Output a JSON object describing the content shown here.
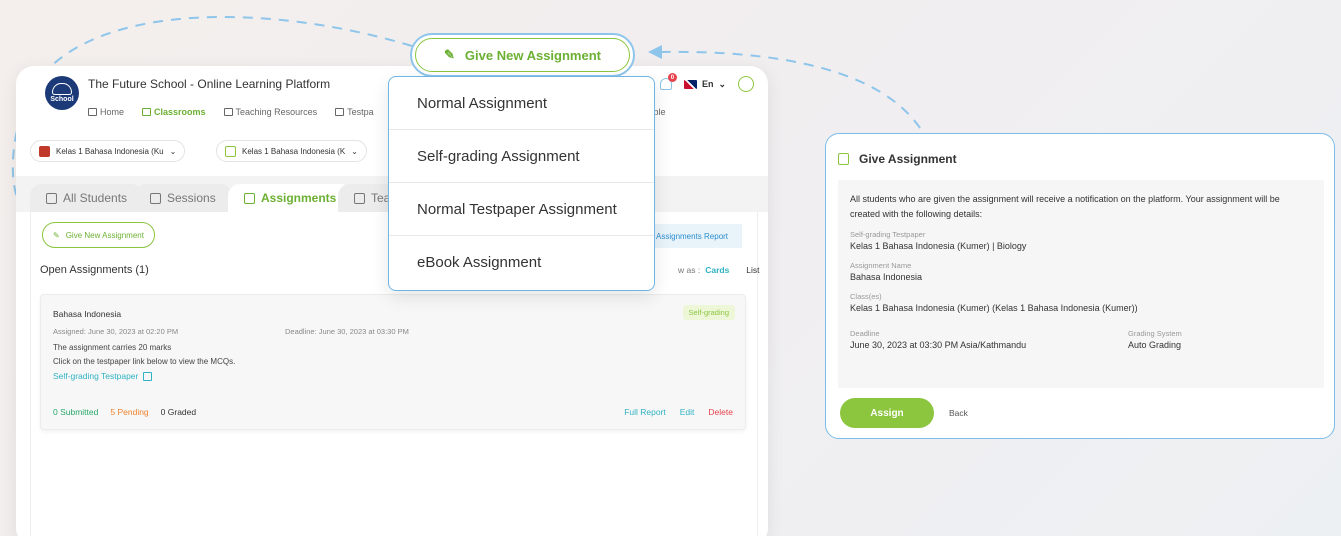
{
  "callout": {
    "label": "Give New Assignment"
  },
  "app": {
    "title": "The Future School - Online Learning Platform",
    "logo_text": "School",
    "nav": [
      "Home",
      "Classrooms",
      "Teaching Resources",
      "Testpa"
    ],
    "nav_tail": "e-Table",
    "notification_count": "0",
    "language": "En",
    "class_selects": [
      "Kelas 1 Bahasa Indonesia (Ku",
      "Kelas 1 Bahasa Indonesia (K"
    ],
    "tabs": [
      "All Students",
      "Sessions",
      "Assignments",
      "Tea"
    ],
    "give_small": "Give New Assignment",
    "report": "Assignments Report",
    "open_title": "Open Assignments (1)",
    "view_as": "w as :",
    "view_cards": "Cards",
    "view_list": "List",
    "card": {
      "name": "Bahasa Indonesia",
      "badge": "Self-grading",
      "assigned": "Assigned: June 30, 2023 at 02:20 PM",
      "deadline": "Deadline: June 30, 2023 at 03:30 PM",
      "marks": "The assignment carries 20 marks",
      "click": "Click on the testpaper link below to view the MCQs.",
      "link": "Self-grading Testpaper",
      "submitted": "0 Submitted",
      "pending": "5 Pending",
      "graded": "0 Graded",
      "full_report": "Full Report",
      "edit": "Edit",
      "delete": "Delete"
    }
  },
  "dropdown": [
    "Normal Assignment",
    "Self-grading Assignment",
    "Normal Testpaper Assignment",
    "eBook Assignment"
  ],
  "give": {
    "title": "Give Assignment",
    "intro": "All students who are given the assignment will receive a notification on the platform. Your assignment will be created with the following details:",
    "tp_label": "Self-grading Testpaper",
    "tp_value": "Kelas 1 Bahasa Indonesia (Kumer) | Biology",
    "name_label": "Assignment Name",
    "name_value": "Bahasa Indonesia",
    "class_label": "Class(es)",
    "class_value": "Kelas 1 Bahasa Indonesia (Kumer) (Kelas 1 Bahasa Indonesia (Kumer))",
    "deadline_label": "Deadline",
    "deadline_value": "June 30, 2023 at 03:30 PM Asia/Kathmandu",
    "grading_label": "Grading System",
    "grading_value": "Auto Grading",
    "assign": "Assign",
    "back": "Back"
  },
  "colors": {
    "green": "#8cc63f",
    "blue": "#7cbde9",
    "red": "#e8434d",
    "orange": "#f0822e"
  }
}
